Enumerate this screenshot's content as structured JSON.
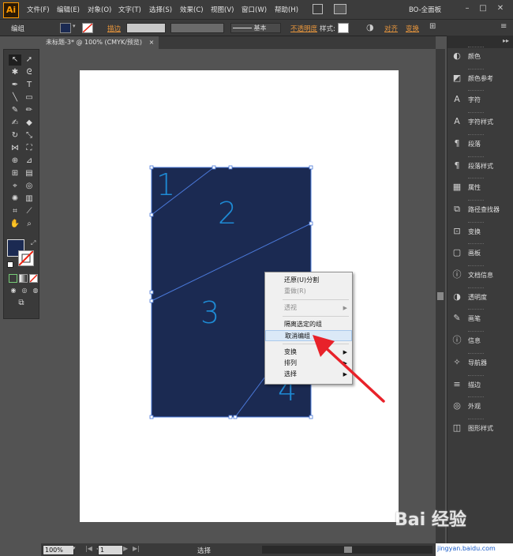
{
  "menubar": {
    "logo": "Ai",
    "items": [
      "文件(F)",
      "编辑(E)",
      "对象(O)",
      "文字(T)",
      "选择(S)",
      "效果(C)",
      "视图(V)",
      "窗口(W)",
      "帮助(H)"
    ],
    "workspace": "BO-全面板"
  },
  "control": {
    "selection_label": "编组",
    "stroke_label": "描边",
    "stroke_profile": "基本",
    "opacity_label": "不透明度",
    "style_label": "样式:",
    "align_label": "对齐",
    "transform_label": "变换"
  },
  "document": {
    "tab_title": "未标题-3* @ 100% (CMYK/预览)",
    "tab_close": "×"
  },
  "artwork": {
    "fill_color": "#1b2a52",
    "number_color": "#1e8ad4",
    "numbers": [
      "1",
      "2",
      "3",
      "4"
    ]
  },
  "context_menu": {
    "items": [
      {
        "label": "还原(U)分割",
        "enabled": true
      },
      {
        "label": "重做(R)",
        "enabled": false
      },
      {
        "label": "透视",
        "enabled": false,
        "submenu": true
      },
      {
        "label": "隔离选定的组",
        "enabled": true
      },
      {
        "label": "取消编组",
        "enabled": true,
        "highlighted": true
      },
      {
        "label": "变换",
        "enabled": true,
        "submenu": true
      },
      {
        "label": "排列",
        "enabled": true,
        "submenu": true
      },
      {
        "label": "选择",
        "enabled": true,
        "submenu": true
      }
    ]
  },
  "panels": [
    {
      "label": "颜色",
      "icon": "color-icon"
    },
    {
      "label": "颜色参考",
      "icon": "color-guide-icon"
    },
    {
      "label": "字符",
      "icon": "character-icon"
    },
    {
      "label": "字符样式",
      "icon": "character-style-icon"
    },
    {
      "label": "段落",
      "icon": "paragraph-icon"
    },
    {
      "label": "段落样式",
      "icon": "paragraph-style-icon"
    },
    {
      "label": "属性",
      "icon": "attributes-icon"
    },
    {
      "label": "路径查找器",
      "icon": "pathfinder-icon"
    },
    {
      "label": "变换",
      "icon": "transform-icon"
    },
    {
      "label": "画板",
      "icon": "artboard-icon"
    },
    {
      "label": "文档信息",
      "icon": "doc-info-icon"
    },
    {
      "label": "透明度",
      "icon": "transparency-icon"
    },
    {
      "label": "画笔",
      "icon": "brush-icon"
    },
    {
      "label": "信息",
      "icon": "info-icon"
    },
    {
      "label": "导航器",
      "icon": "navigator-icon"
    },
    {
      "label": "描边",
      "icon": "stroke-icon"
    },
    {
      "label": "外观",
      "icon": "appearance-icon"
    },
    {
      "label": "图形样式",
      "icon": "graphic-style-icon"
    }
  ],
  "statusbar": {
    "zoom": "100%",
    "page": "1",
    "mode": "选择"
  },
  "watermark": {
    "text": "Bai 经验",
    "url": "jingyan.baidu.com"
  }
}
